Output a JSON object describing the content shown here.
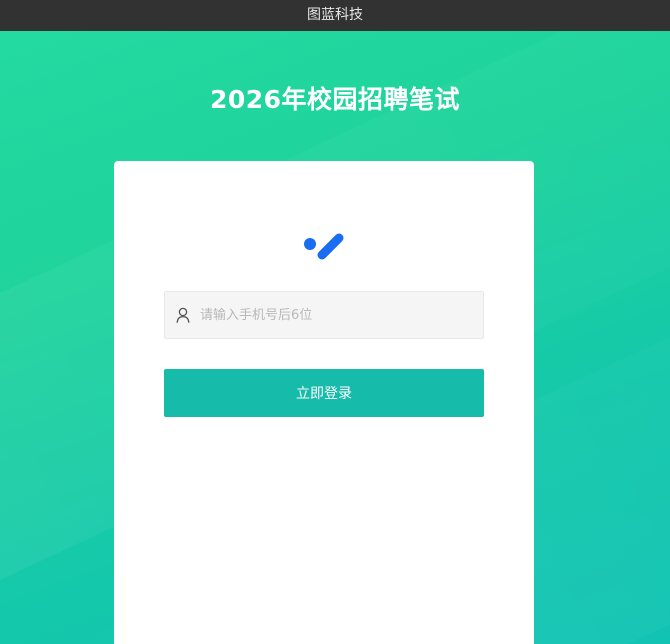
{
  "window": {
    "title": "图蓝科技"
  },
  "page": {
    "title": "2026年校园招聘笔试"
  },
  "login_card": {
    "logo_icon": "brand-logo-icon",
    "phone_input": {
      "icon": "user-icon",
      "value": "",
      "placeholder": "请输入手机号后6位"
    },
    "login_button_label": "立即登录"
  },
  "colors": {
    "background_gradient_start": "#24dba1",
    "background_gradient_end": "#12c3b4",
    "titlebar": "#323232",
    "button": "#16bbaa",
    "logo_blue": "#1a6cf0",
    "input_bg": "#f5f5f5"
  }
}
